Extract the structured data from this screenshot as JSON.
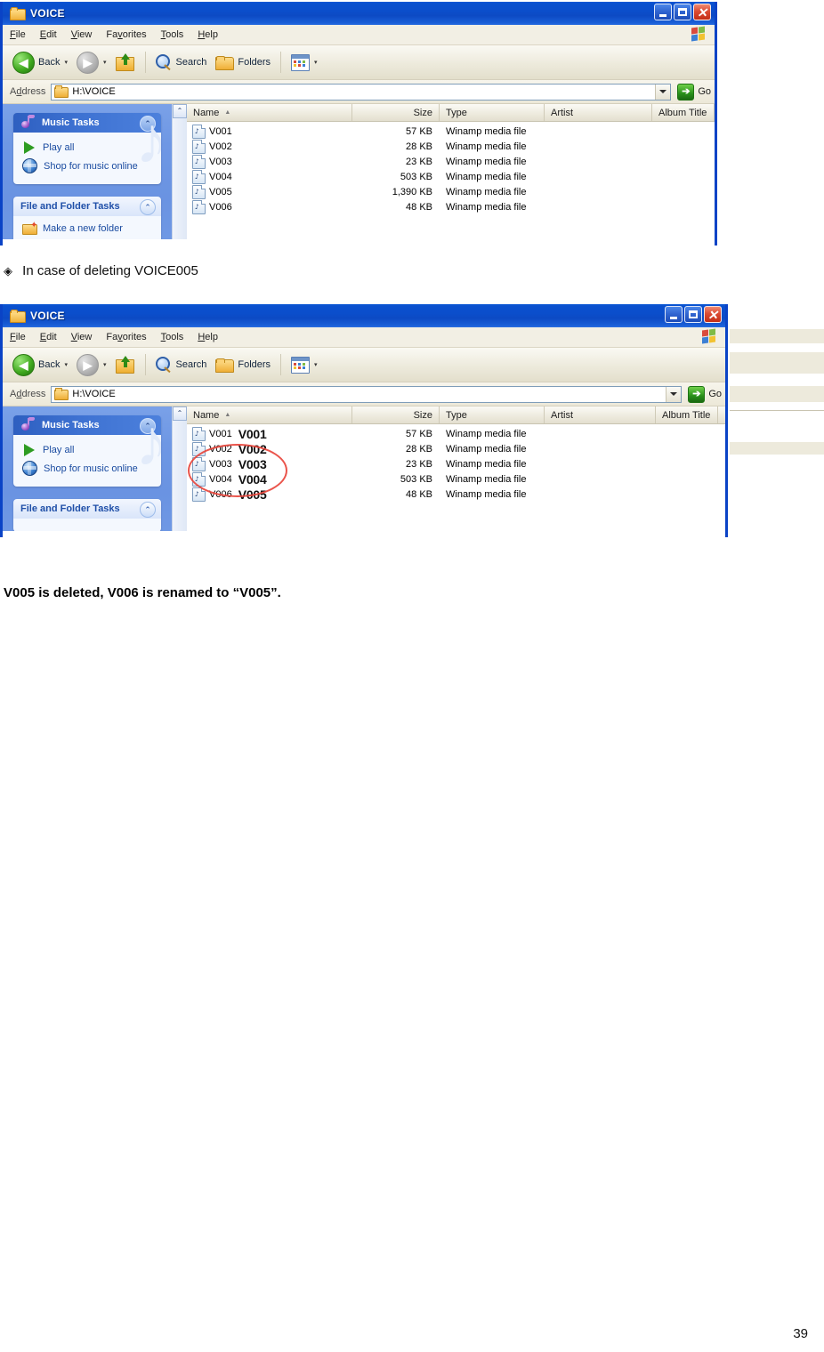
{
  "page": {
    "number": "39",
    "heading": "In case of deleting VOICE005",
    "heading_bullet": "◈",
    "caption": "V005 is deleted, V006 is renamed to “V005”."
  },
  "window": {
    "title": "VOICE",
    "titlebar_buttons": {
      "minimize": "_",
      "maximize": "□",
      "close": "✕"
    },
    "menu": [
      {
        "pre": "",
        "accel": "F",
        "post": "ile"
      },
      {
        "pre": "",
        "accel": "E",
        "post": "dit"
      },
      {
        "pre": "",
        "accel": "V",
        "post": "iew"
      },
      {
        "pre": "Fa",
        "accel": "v",
        "post": "orites"
      },
      {
        "pre": "",
        "accel": "T",
        "post": "ools"
      },
      {
        "pre": "",
        "accel": "H",
        "post": "elp"
      }
    ],
    "toolbar": {
      "back": "Back",
      "search": "Search",
      "folders": "Folders",
      "views_caret": "▾"
    },
    "address": {
      "label_pre": "A",
      "label_accel": "d",
      "label_post": "dress",
      "value": "H:\\VOICE",
      "go_label": "Go",
      "go_arrow": "➔"
    },
    "sidebar": {
      "music_tasks": {
        "title": "Music Tasks",
        "chevron": "⌃",
        "items": [
          {
            "label": "Play all",
            "icon": "play-icon"
          },
          {
            "label": "Shop for music online",
            "icon": "globe-icon"
          }
        ]
      },
      "file_folder_tasks": {
        "title": "File and Folder Tasks",
        "chevron": "⌃",
        "items": [
          {
            "label": "Make a new folder",
            "icon": "new-folder-icon"
          }
        ]
      }
    },
    "columns": [
      {
        "key": "name",
        "label": "Name",
        "sorted": true,
        "sort_arrow": "▲"
      },
      {
        "key": "size",
        "label": "Size"
      },
      {
        "key": "type",
        "label": "Type"
      },
      {
        "key": "artist",
        "label": "Artist"
      },
      {
        "key": "album",
        "label": "Album Title"
      }
    ]
  },
  "screenshot_before": {
    "files": [
      {
        "name": "V001",
        "size": "57 KB",
        "type": "Winamp media file",
        "artist": "",
        "album": ""
      },
      {
        "name": "V002",
        "size": "28 KB",
        "type": "Winamp media file",
        "artist": "",
        "album": ""
      },
      {
        "name": "V003",
        "size": "23 KB",
        "type": "Winamp media file",
        "artist": "",
        "album": ""
      },
      {
        "name": "V004",
        "size": "503 KB",
        "type": "Winamp media file",
        "artist": "",
        "album": ""
      },
      {
        "name": "V005",
        "size": "1,390 KB",
        "type": "Winamp media file",
        "artist": "",
        "album": ""
      },
      {
        "name": "V006",
        "size": "48 KB",
        "type": "Winamp media file",
        "artist": "",
        "album": ""
      }
    ]
  },
  "screenshot_after": {
    "files": [
      {
        "name": "V001",
        "overlay": "V001",
        "size": "57 KB",
        "type": "Winamp media file",
        "artist": "",
        "album": ""
      },
      {
        "name": "V002",
        "overlay": "V002",
        "size": "28 KB",
        "type": "Winamp media file",
        "artist": "",
        "album": ""
      },
      {
        "name": "V003",
        "overlay": "V003",
        "size": "23 KB",
        "type": "Winamp media file",
        "artist": "",
        "album": ""
      },
      {
        "name": "V004",
        "overlay": "V004",
        "size": "503 KB",
        "type": "Winamp media file",
        "artist": "",
        "album": ""
      },
      {
        "name": "V006",
        "overlay": "V005",
        "size": "48 KB",
        "type": "Winamp media file",
        "artist": "",
        "album": ""
      }
    ],
    "highlight": {
      "shape": "ellipse",
      "color": "#E8453C"
    }
  },
  "colors": {
    "titlebar_blue": "#0B4ECB",
    "sidebar_blue": "#6E97E4",
    "panel_header_blue": "#2E5FC0",
    "task_link": "#1A4BA0",
    "annotation_red": "#E8453C",
    "toolbar_beige": "#EDEADC"
  }
}
